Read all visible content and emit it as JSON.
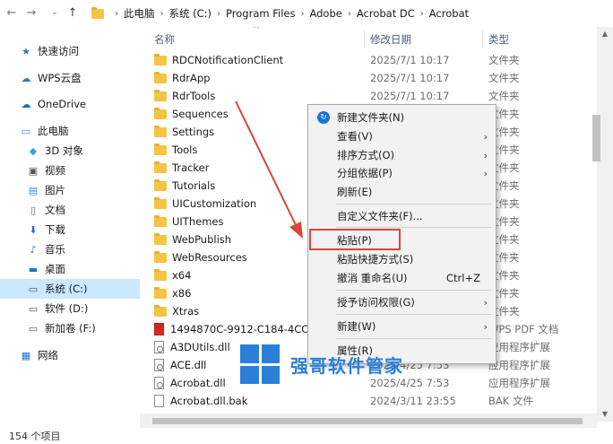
{
  "address": {
    "crumbs": [
      "此电脑",
      "系统 (C:)",
      "Program Files",
      "Adobe",
      "Acrobat DC",
      "Acrobat"
    ]
  },
  "sidebar": {
    "items": [
      {
        "label": "快速访问",
        "icon": "star-icon"
      },
      {
        "label": "WPS云盘",
        "icon": "cloud-icon"
      },
      {
        "label": "OneDrive",
        "icon": "onedrive-icon"
      },
      {
        "label": "此电脑",
        "icon": "computer-icon"
      },
      {
        "label": "3D 对象",
        "icon": "cube-icon"
      },
      {
        "label": "视频",
        "icon": "video-icon"
      },
      {
        "label": "图片",
        "icon": "picture-icon"
      },
      {
        "label": "文档",
        "icon": "document-icon"
      },
      {
        "label": "下载",
        "icon": "download-icon"
      },
      {
        "label": "音乐",
        "icon": "music-icon"
      },
      {
        "label": "桌面",
        "icon": "desktop-icon"
      },
      {
        "label": "系统 (C:)",
        "icon": "drive-icon"
      },
      {
        "label": "软件 (D:)",
        "icon": "drive-icon"
      },
      {
        "label": "新加卷 (F:)",
        "icon": "drive-icon"
      },
      {
        "label": "网络",
        "icon": "network-icon"
      }
    ]
  },
  "columns": {
    "name": "名称",
    "date": "修改日期",
    "type": "类型"
  },
  "files": [
    {
      "name": "RDCNotificationClient",
      "date": "2025/7/1 10:17",
      "type": "文件夹",
      "kind": "folder"
    },
    {
      "name": "RdrApp",
      "date": "2025/7/1 10:17",
      "type": "文件夹",
      "kind": "folder"
    },
    {
      "name": "RdrTools",
      "date": "2025/7/1 10:17",
      "type": "文件夹",
      "kind": "folder"
    },
    {
      "name": "Sequences",
      "date": "",
      "type": "文件夹",
      "kind": "folder"
    },
    {
      "name": "Settings",
      "date": "",
      "type": "文件夹",
      "kind": "folder"
    },
    {
      "name": "Tools",
      "date": "",
      "type": "文件夹",
      "kind": "folder"
    },
    {
      "name": "Tracker",
      "date": "",
      "type": "文件夹",
      "kind": "folder"
    },
    {
      "name": "Tutorials",
      "date": "",
      "type": "文件夹",
      "kind": "folder"
    },
    {
      "name": "UICustomization",
      "date": "",
      "type": "文件夹",
      "kind": "folder"
    },
    {
      "name": "UIThemes",
      "date": "",
      "type": "文件夹",
      "kind": "folder"
    },
    {
      "name": "WebPublish",
      "date": "",
      "type": "文件夹",
      "kind": "folder"
    },
    {
      "name": "WebResources",
      "date": "",
      "type": "文件夹",
      "kind": "folder"
    },
    {
      "name": "x64",
      "date": "",
      "type": "文件夹",
      "kind": "folder"
    },
    {
      "name": "x86",
      "date": "",
      "type": "文件夹",
      "kind": "folder"
    },
    {
      "name": "Xtras",
      "date": "",
      "type": "文件夹",
      "kind": "folder"
    },
    {
      "name": "1494870C-9912-C184-4CC9-",
      "date": "",
      "type": "WPS PDF 文档",
      "kind": "pdf"
    },
    {
      "name": "A3DUtils.dll",
      "date": "",
      "type": "应用程序扩展",
      "kind": "dll"
    },
    {
      "name": "ACE.dll",
      "date": "2025/4/25 7:53",
      "type": "应用程序扩展",
      "kind": "dll"
    },
    {
      "name": "Acrobat.dll",
      "date": "2025/4/25 7:53",
      "type": "应用程序扩展",
      "kind": "dll"
    },
    {
      "name": "Acrobat.dll.bak",
      "date": "2024/3/11 23:55",
      "type": "BAK 文件",
      "kind": "file"
    }
  ],
  "menu": {
    "items": [
      {
        "label": "新建文件夹(N)",
        "shortcut": "",
        "submenu": false,
        "icon": "new-folder-icon"
      },
      {
        "label": "查看(V)",
        "shortcut": "",
        "submenu": true
      },
      {
        "label": "排序方式(O)",
        "shortcut": "",
        "submenu": true
      },
      {
        "label": "分组依据(P)",
        "shortcut": "",
        "submenu": true
      },
      {
        "label": "刷新(E)",
        "shortcut": "",
        "submenu": false
      },
      {
        "label": "自定义文件夹(F)...",
        "shortcut": "",
        "submenu": false
      },
      {
        "label": "粘贴(P)",
        "shortcut": "",
        "submenu": false
      },
      {
        "label": "粘贴快捷方式(S)",
        "shortcut": "",
        "submenu": false
      },
      {
        "label": "撤消 重命名(U)",
        "shortcut": "Ctrl+Z",
        "submenu": false
      },
      {
        "label": "授予访问权限(G)",
        "shortcut": "",
        "submenu": true
      },
      {
        "label": "新建(W)",
        "shortcut": "",
        "submenu": true
      },
      {
        "label": "属性(R)",
        "shortcut": "",
        "submenu": false
      }
    ]
  },
  "status": {
    "count": "154 个项目"
  },
  "watermark": {
    "text": "强哥软件管家"
  },
  "colors": {
    "selection": "#cce8ff",
    "highlight_box": "#d9463a",
    "arrow": "#d9463a",
    "watermark": "#2b7fd8",
    "folder": "#f6c445"
  }
}
